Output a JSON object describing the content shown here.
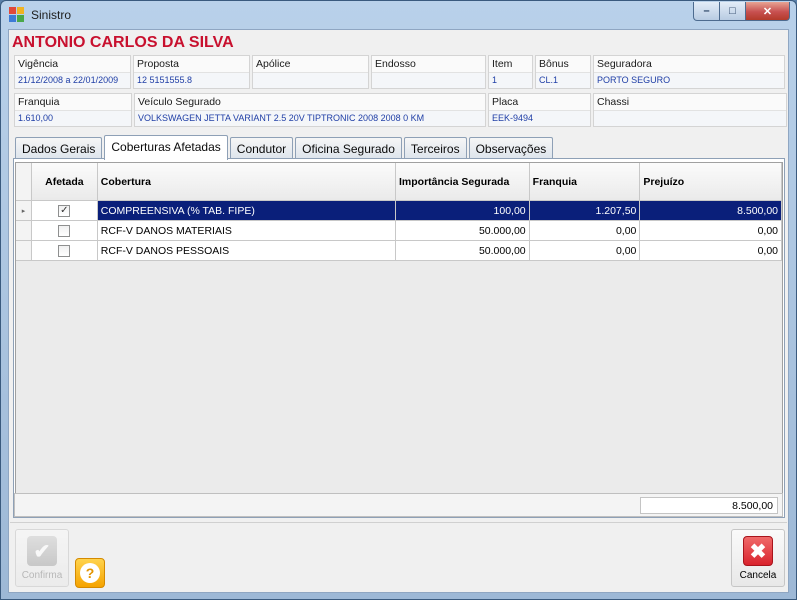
{
  "window": {
    "title": "Sinistro",
    "min_glyph": "–",
    "max_glyph": "□",
    "close_glyph": "✕"
  },
  "insured_name": "ANTONIO CARLOS DA SILVA",
  "info_row1": [
    {
      "label": "Vigência",
      "value": "21/12/2008 a 22/01/2009"
    },
    {
      "label": "Proposta",
      "value": "12 5151555.8"
    },
    {
      "label": "Apólice",
      "value": ""
    },
    {
      "label": "Endosso",
      "value": ""
    },
    {
      "label": "Item",
      "value": "1"
    },
    {
      "label": "Bônus",
      "value": "CL.1"
    },
    {
      "label": "Seguradora",
      "value": "PORTO SEGURO"
    }
  ],
  "info_row2": [
    {
      "label": "Franquia",
      "value": "1.610,00"
    },
    {
      "label": "Veículo Segurado",
      "value": "VOLKSWAGEN JETTA VARIANT 2.5 20V TIPTRONIC 2008 2008 0 KM"
    },
    {
      "label": "Placa",
      "value": "EEK-9494"
    },
    {
      "label": "Chassi",
      "value": ""
    }
  ],
  "tabs": [
    {
      "label": "Dados Gerais",
      "active": false
    },
    {
      "label": "Coberturas Afetadas",
      "active": true
    },
    {
      "label": "Condutor",
      "active": false
    },
    {
      "label": "Oficina Segurado",
      "active": false
    },
    {
      "label": "Terceiros",
      "active": false
    },
    {
      "label": "Observações",
      "active": false
    }
  ],
  "grid": {
    "headers": [
      "Afetada",
      "Cobertura",
      "Importância Segurada",
      "Franquia",
      "Prejuízo"
    ],
    "rows": [
      {
        "affected": true,
        "coverage": "COMPREENSIVA (% TAB. FIPE)",
        "insured_amount": "100,00",
        "deductible": "1.207,50",
        "loss": "8.500,00",
        "selected": true
      },
      {
        "affected": false,
        "coverage": "RCF-V DANOS MATERIAIS",
        "insured_amount": "50.000,00",
        "deductible": "0,00",
        "loss": "0,00",
        "selected": false
      },
      {
        "affected": false,
        "coverage": "RCF-V DANOS PESSOAIS",
        "insured_amount": "50.000,00",
        "deductible": "0,00",
        "loss": "0,00",
        "selected": false
      }
    ],
    "total_loss": "8.500,00",
    "row_marker": "▸",
    "check_glyph": "✓"
  },
  "buttons": {
    "confirm": {
      "label": "Confirma",
      "icon": "checkmark-icon",
      "enabled": false,
      "glyph": "✔"
    },
    "help": {
      "icon": "help-icon",
      "glyph": "?"
    },
    "cancel": {
      "label": "Cancela",
      "icon": "close-x-icon",
      "glyph": "✖"
    }
  },
  "colors": {
    "insured_name": "#c8102e",
    "value_text": "#1f3ea6",
    "selection": "#0a1f7a",
    "cancel_icon": "#d9232d",
    "help_icon": "#f5a300"
  }
}
